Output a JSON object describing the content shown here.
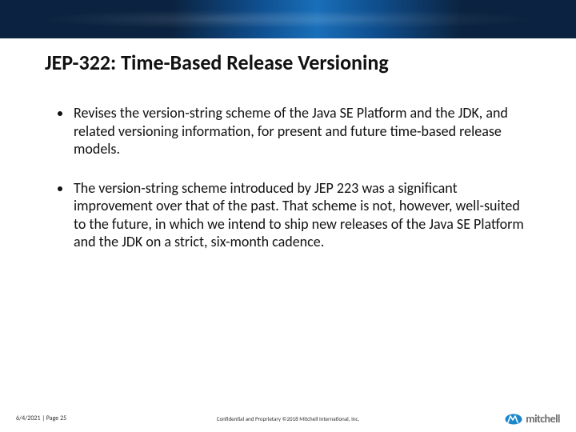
{
  "title": "JEP-322: Time-Based Release Versioning",
  "bullets": [
    "Revises the version-string scheme of the Java SE Platform and the JDK, and related versioning information, for present and future time-based release models.",
    "The version-string scheme introduced by JEP 223 was a significant improvement over that of the past. That scheme is not, however, well-suited to the future, in which we intend to ship new releases of the Java SE Platform and the JDK on a strict, six-month cadence."
  ],
  "footer": {
    "date_page": "6/4/2021  |  Page 25",
    "confidential": "Confidential and Proprietary  ©2018 Mitchell International, Inc.",
    "logo_text": "mitchell"
  }
}
